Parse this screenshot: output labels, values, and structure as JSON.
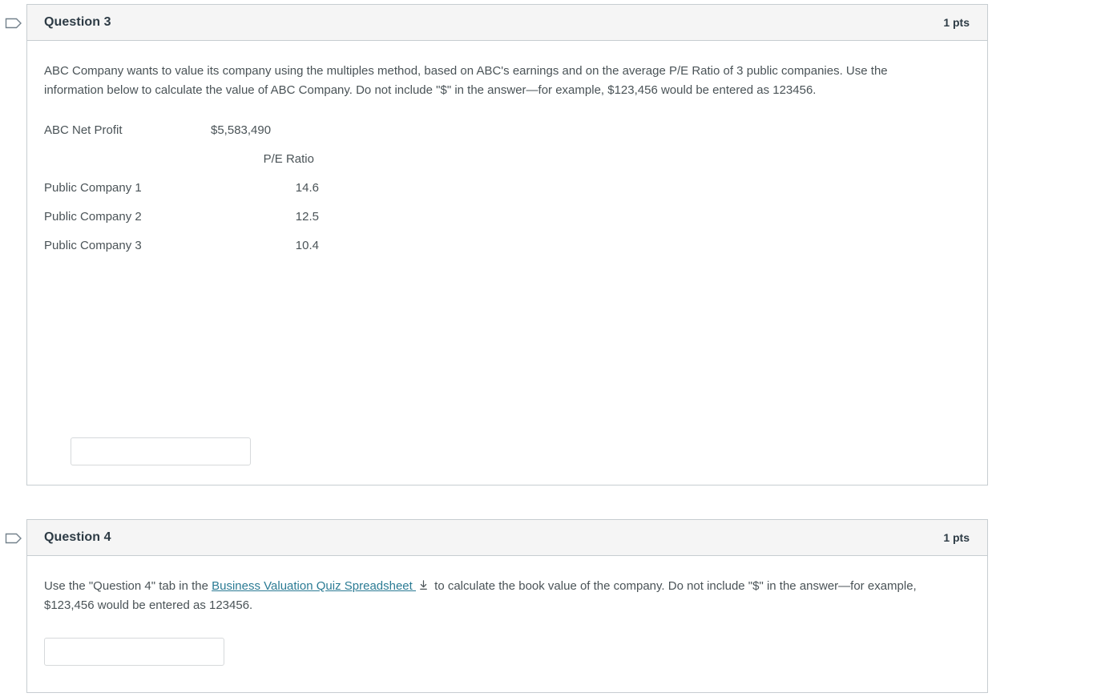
{
  "questions": [
    {
      "flag_icon": "flag-outline-icon",
      "title": "Question 3",
      "points": "1 pts",
      "prompt": "ABC Company wants to value its company using the multiples method, based on ABC's earnings and on the average P/E Ratio of 3 public companies. Use the information below to calculate the value of ABC Company. Do not include \"$\" in the answer—for example, $123,456 would be entered as 123456.",
      "table": {
        "net_profit_label": "ABC Net Profit",
        "net_profit_value": "$5,583,490",
        "ratio_header": "P/E Ratio",
        "rows": [
          {
            "label": "Public Company 1",
            "value": "14.6"
          },
          {
            "label": "Public Company 2",
            "value": "12.5"
          },
          {
            "label": "Public Company 3",
            "value": "10.4"
          }
        ]
      },
      "answer": {
        "value": "",
        "placeholder": ""
      }
    },
    {
      "flag_icon": "flag-outline-icon",
      "title": "Question 4",
      "points": "1 pts",
      "prompt_before_link": "Use the \"Question 4\" tab in the ",
      "link_text": "Business Valuation Quiz Spreadsheet ",
      "download_icon": "download-icon",
      "prompt_after_link": " to calculate the book value of the company. Do not include \"$\" in the answer—for example, $123,456 would be entered as 123456.",
      "answer": {
        "value": "",
        "placeholder": ""
      }
    }
  ],
  "colors": {
    "header_background": "#f5f5f5",
    "border": "#c7cdd1",
    "text": "#2d3b45",
    "body_text": "#4a5357",
    "link": "#2b7b94",
    "input_border": "#d6d9db",
    "flag_icon": "#73818c"
  }
}
